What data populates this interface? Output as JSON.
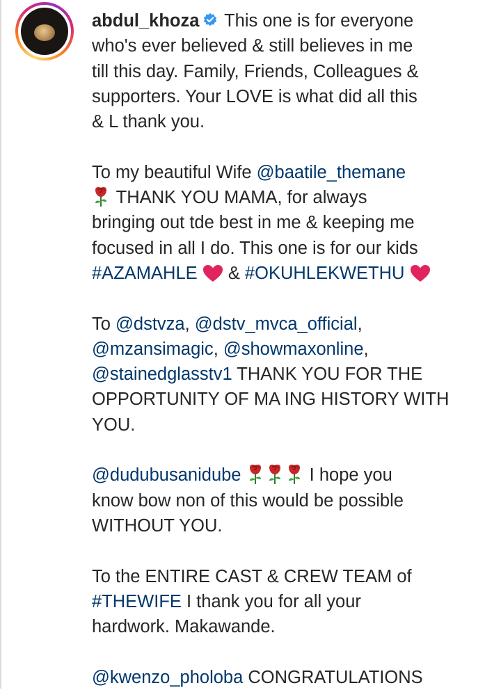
{
  "post": {
    "username": "abdul_khoza",
    "verified_icon": "verified-badge-icon",
    "avatar_icon": "moon-avatar",
    "colors": {
      "mention": "#00376b",
      "verified": "#3897f0",
      "heart": "#e0245e",
      "text": "#262626"
    },
    "p1": {
      "text": " This one is for everyone\nwho's ever believed & still believes in me\ntill this day. Family, Friends, Colleagues &\nsupporters. Your LOVE is what did all this\n& L thank you."
    },
    "p2": {
      "t1": "To my beautiful Wife ",
      "m1": "@baatile_themane",
      "t2": " THANK YOU MAMA, for always\nbringing out tde best in me & keeping me\nfocused in all I do. This one is for our kids\n",
      "h1": "#AZAMAHLE",
      "t3": " & ",
      "h2": "#OKUHLEKWETHU"
    },
    "p3": {
      "t1": "To ",
      "m1": "@dstvza",
      "t2": ", ",
      "m2": "@dstv_mvca_official",
      "t3": ",\n",
      "m3": "@mzansimagic",
      "t4": ", ",
      "m4": "@showmaxonline",
      "t5": ",\n",
      "m5": "@stainedglasstv1",
      "t6": " THANK YOU FOR THE\nOPPORTUNITY OF MA ING HISTORY WITH\nYOU."
    },
    "p4": {
      "m1": "@dudubusanidube",
      "t1": " I hope you\nknow bow non of this would be possible\nWITHOUT YOU."
    },
    "p5": {
      "t1": "To the ENTIRE CAST & CREW TEAM of\n",
      "h1": "#THEWIFE",
      "t2": " I thank you for all your\nhardwork. Makawande."
    },
    "p6": {
      "m1": "@kwenzo_pholoba",
      "t1": " CONGRATULATIONS"
    }
  }
}
